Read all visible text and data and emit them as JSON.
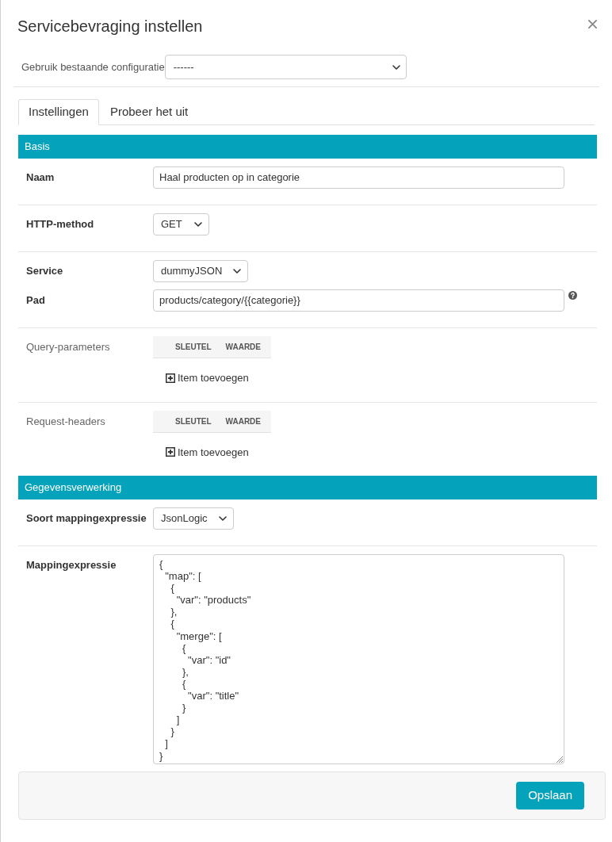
{
  "dialog": {
    "title": "Servicebevraging instellen"
  },
  "config": {
    "label": "Gebruik bestaande configuratie",
    "value": "------"
  },
  "tabs": [
    {
      "label": "Instellingen",
      "selected": true
    },
    {
      "label": "Probeer het uit",
      "selected": false
    }
  ],
  "sections": [
    {
      "title": "Basis",
      "groups": [
        {
          "fields": [
            {
              "kind": "text",
              "label": "Naam",
              "value": "Haal producten op in categorie"
            }
          ]
        },
        {
          "fields": [
            {
              "kind": "select",
              "label": "HTTP-method",
              "value": "GET"
            }
          ]
        },
        {
          "fields": [
            {
              "kind": "select",
              "label": "Service",
              "value": "dummyJSON"
            },
            {
              "kind": "text",
              "label": "Pad",
              "value": "products/category/{{categorie}}",
              "help": true
            }
          ]
        },
        {
          "fields": [
            {
              "kind": "keyvalue",
              "label": "Query-parameters",
              "columns": [
                "SLEUTEL",
                "WAARDE"
              ],
              "add_label": "Item toevoegen"
            }
          ]
        },
        {
          "fields": [
            {
              "kind": "keyvalue",
              "label": "Request-headers",
              "columns": [
                "SLEUTEL",
                "WAARDE"
              ],
              "add_label": "Item toevoegen"
            }
          ]
        }
      ]
    },
    {
      "title": "Gegevensverwerking",
      "groups": [
        {
          "fields": [
            {
              "kind": "select",
              "label": "Soort mappingexpressie",
              "value": "JsonLogic"
            }
          ]
        },
        {
          "fields": [
            {
              "kind": "textarea",
              "label": "Mappingexpressie",
              "value": "{\n  \"map\": [\n    {\n      \"var\": \"products\"\n    },\n    {\n      \"merge\": [\n        {\n          \"var\": \"id\"\n        },\n        {\n          \"var\": \"title\"\n        }\n      ]\n    }\n  ]\n}"
            }
          ]
        }
      ]
    }
  ],
  "footer": {
    "button": "Opslaan"
  }
}
